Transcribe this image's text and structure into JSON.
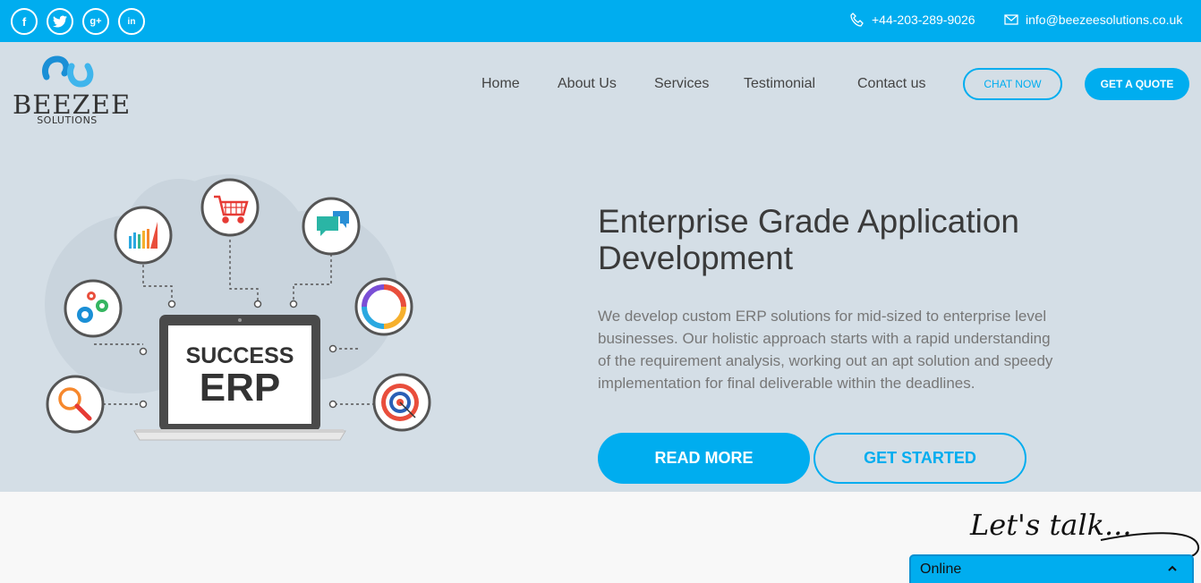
{
  "topbar": {
    "social": [
      {
        "icon": "facebook-icon",
        "glyph": "f"
      },
      {
        "icon": "twitter-icon",
        "glyph": ""
      },
      {
        "icon": "google-plus-icon",
        "glyph": "g+"
      },
      {
        "icon": "linkedin-icon",
        "glyph": "in"
      }
    ],
    "phone": "+44-203-289-9026",
    "email": "info@beezeesolutions.co.uk"
  },
  "logo": {
    "word": "BEEZEE",
    "sub": "SOLUTIONS"
  },
  "nav": {
    "items": [
      "Home",
      "About Us",
      "Services",
      "Testimonial",
      "Contact us"
    ]
  },
  "buttons": {
    "chat": "CHAT NOW",
    "quote": "GET A QUOTE",
    "read_more": "READ MORE",
    "get_started": "GET STARTED"
  },
  "illustration": {
    "line1": "SUCCESS",
    "line2": "ERP"
  },
  "hero": {
    "headline": "Enterprise Grade Application Development",
    "description": "We develop custom ERP solutions for mid-sized to enterprise level businesses. Our holistic approach starts with a rapid understanding of the requirement analysis, working out an apt solution and speedy implementation for final deliverable within the deadlines."
  },
  "chat_widget": {
    "tagline": "Let's talk...",
    "status": "Online"
  },
  "colors": {
    "accent": "#00adef",
    "hero_bg": "#d4dee6",
    "page_bg": "#f8f8f8"
  }
}
